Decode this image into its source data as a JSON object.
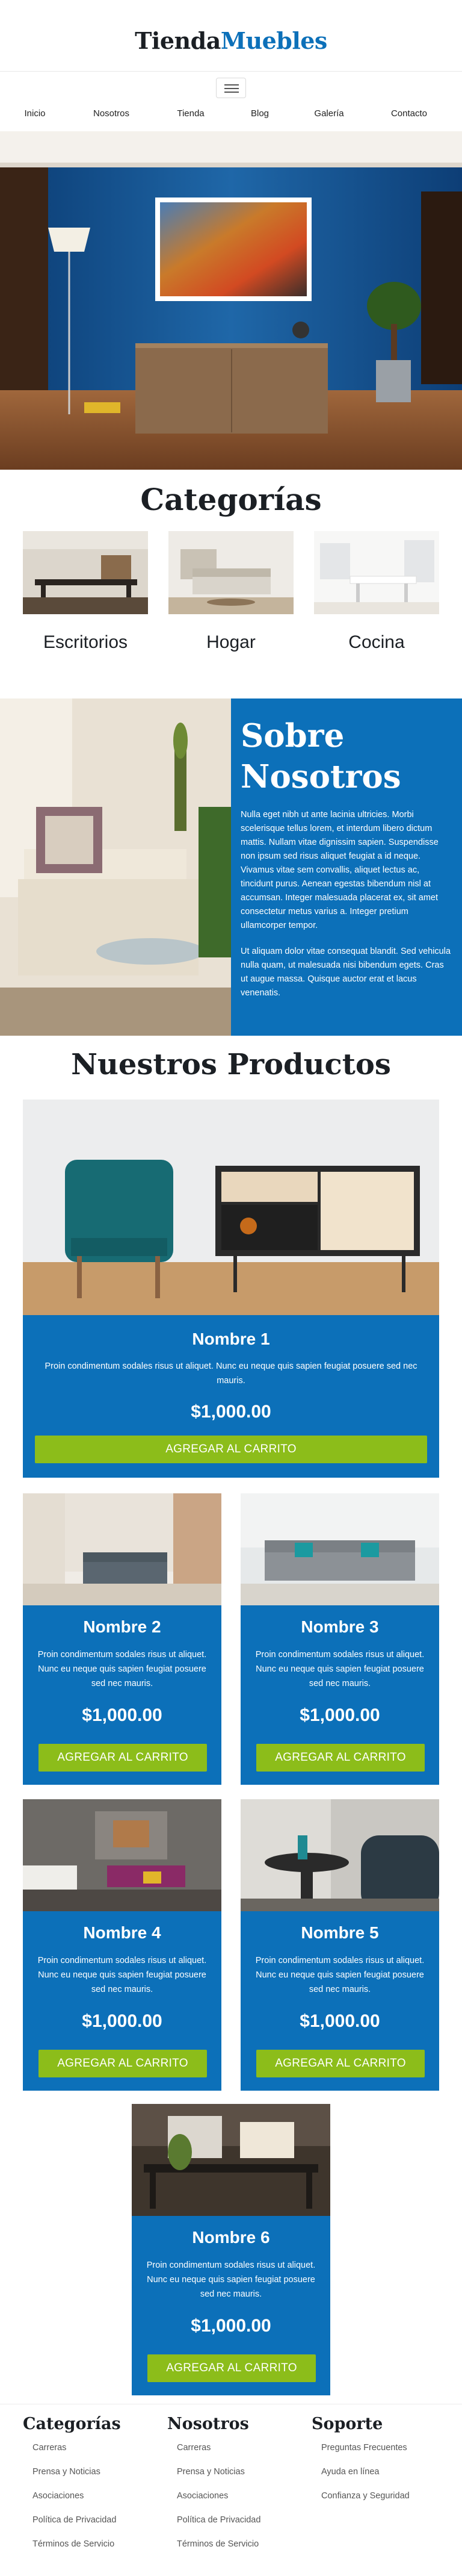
{
  "brand": {
    "part1": "Tienda",
    "part2": "Muebles"
  },
  "nav": [
    "Inicio",
    "Nosotros",
    "Tienda",
    "Blog",
    "Galería",
    "Contacto"
  ],
  "categories": {
    "title": "Categorías",
    "items": [
      "Escritorios",
      "Hogar",
      "Cocina"
    ]
  },
  "about": {
    "title": "Sobre Nosotros",
    "p1": "Nulla eget nibh ut ante lacinia ultricies. Morbi scelerisque tellus lorem, et interdum libero dictum mattis. Nullam vitae dignissim sapien. Suspendisse non ipsum sed risus aliquet feugiat a id neque. Vivamus vitae sem convallis, aliquet lectus ac, tincidunt purus. Aenean egestas bibendum nisl at accumsan. Integer malesuada placerat ex, sit amet consectetur metus varius a. Integer pretium ullamcorper tempor.",
    "p2": "Ut aliquam dolor vitae consequat blandit. Sed vehicula nulla quam, ut malesuada nisi bibendum egets. Cras ut augue massa. Quisque auctor erat et lacus venenatis."
  },
  "products": {
    "title": "Nuestros Productos",
    "items": [
      {
        "name": "Nombre 1",
        "desc": "Proin condimentum sodales risus ut aliquet. Nunc eu neque quis sapien feugiat posuere sed nec mauris.",
        "price": "$1,000.00",
        "button": "AGREGAR AL CARRITO"
      },
      {
        "name": "Nombre 2",
        "desc": "Proin condimentum sodales risus ut aliquet. Nunc eu neque quis sapien feugiat posuere sed nec mauris.",
        "price": "$1,000.00",
        "button": "AGREGAR AL CARRITO"
      },
      {
        "name": "Nombre 3",
        "desc": "Proin condimentum sodales risus ut aliquet. Nunc eu neque quis sapien feugiat posuere sed nec mauris.",
        "price": "$1,000.00",
        "button": "AGREGAR AL CARRITO"
      },
      {
        "name": "Nombre 4",
        "desc": "Proin condimentum sodales risus ut aliquet. Nunc eu neque quis sapien feugiat posuere sed nec mauris.",
        "price": "$1,000.00",
        "button": "AGREGAR AL CARRITO"
      },
      {
        "name": "Nombre 5",
        "desc": "Proin condimentum sodales risus ut aliquet. Nunc eu neque quis sapien feugiat posuere sed nec mauris.",
        "price": "$1,000.00",
        "button": "AGREGAR AL CARRITO"
      },
      {
        "name": "Nombre 6",
        "desc": "Proin condimentum sodales risus ut aliquet. Nunc eu neque quis sapien feugiat posuere sed nec mauris.",
        "price": "$1,000.00",
        "button": "AGREGAR AL CARRITO"
      }
    ]
  },
  "footer": {
    "col1": {
      "title": "Categorías",
      "links": [
        "Carreras",
        "Prensa y Noticias",
        "Asociaciones",
        "Política de Privacidad",
        "Términos de Servicio"
      ]
    },
    "col2": {
      "title": "Nosotros",
      "links": [
        "Carreras",
        "Prensa y Noticias",
        "Asociaciones",
        "Política de Privacidad",
        "Términos de Servicio"
      ]
    },
    "col3": {
      "title": "Soporte",
      "links": [
        "Preguntas Frecuentes",
        "Ayuda en línea",
        "Confianza y Seguridad"
      ]
    }
  },
  "colors": {
    "brand_blue": "#0c70b9",
    "button_green": "#8cbd1a",
    "heading_dark": "#1b1f24"
  }
}
